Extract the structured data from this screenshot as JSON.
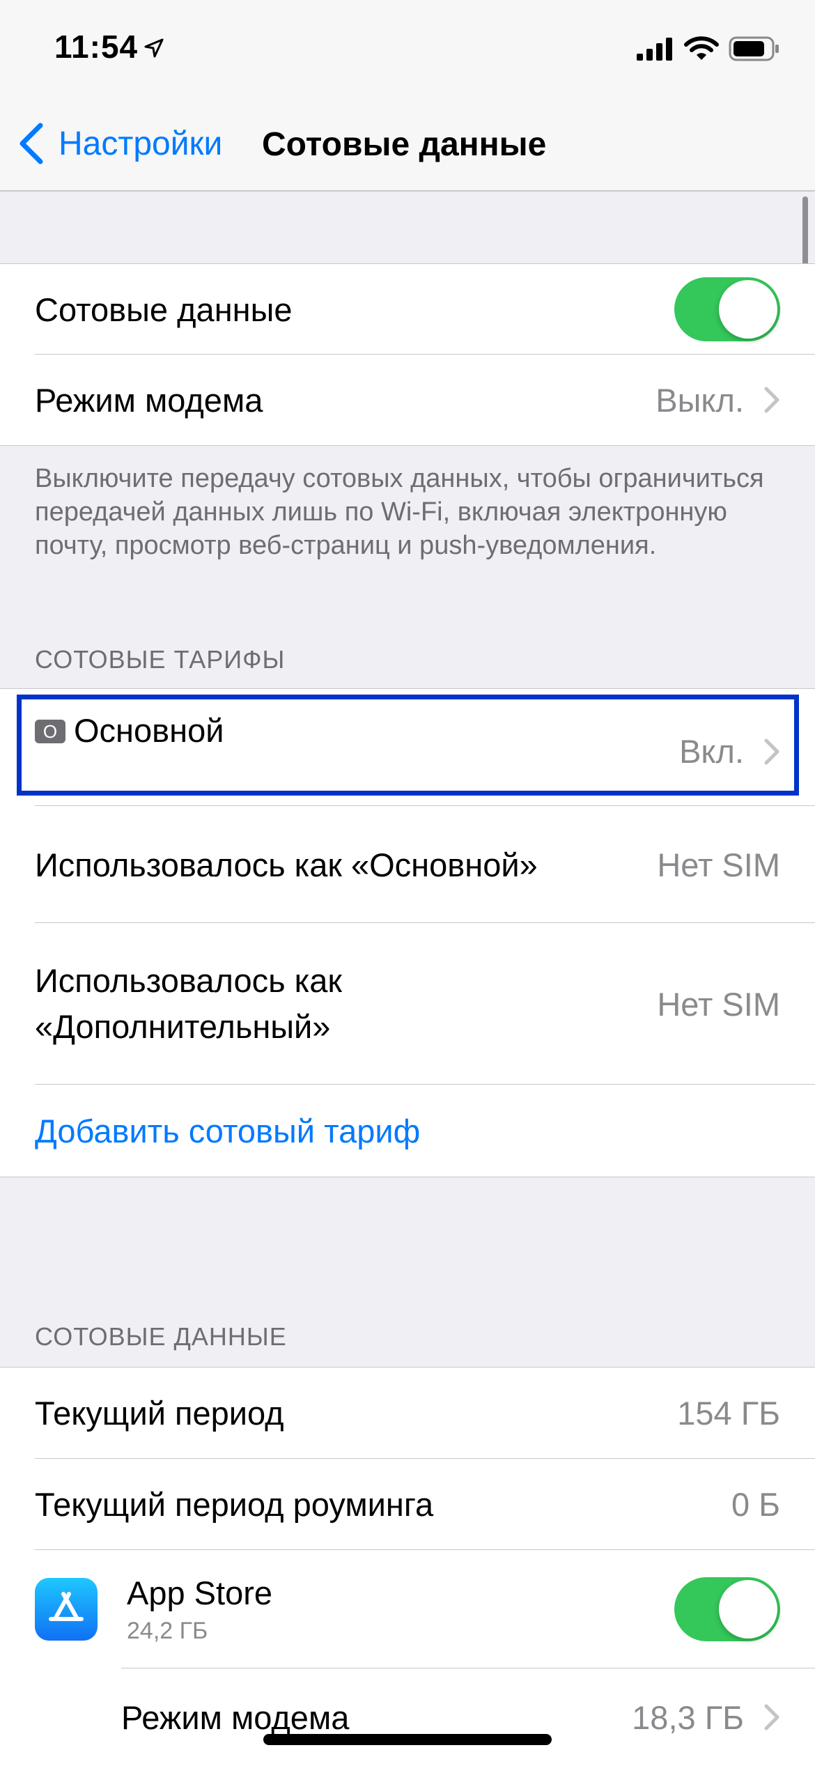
{
  "status_bar": {
    "time": "11:54"
  },
  "nav": {
    "back_label": "Настройки",
    "title": "Сотовые данные"
  },
  "section_main": {
    "cellular_data_label": "Сотовые данные",
    "cellular_data_on": true,
    "hotspot_label": "Режим модема",
    "hotspot_value": "Выкл."
  },
  "footer_note": "Выключите передачу сотовых данных, чтобы ограничиться передачей данных лишь по Wi-Fi, включая электронную почту, просмотр веб-страниц и push-уведомления.",
  "plans": {
    "header": "СОТОВЫЕ ТАРИФЫ",
    "primary_badge": "O",
    "primary_label": "Основной",
    "primary_value": "Вкл.",
    "used_primary_label": "Использовалось как «Основной»",
    "used_primary_value": "Нет SIM",
    "used_secondary_label_line1": "Использовалось как",
    "used_secondary_label_line2": "«Дополнительный»",
    "used_secondary_value": "Нет SIM",
    "add_plan_label": "Добавить сотовый тариф"
  },
  "data_usage": {
    "header": "СОТОВЫЕ ДАННЫЕ",
    "current_period_label": "Текущий период",
    "current_period_value": "154 ГБ",
    "roaming_label": "Текущий период роуминга",
    "roaming_value": "0 Б",
    "app_store_label": "App Store",
    "app_store_usage": "24,2 ГБ",
    "app_store_on": true,
    "hotspot_label": "Режим модема",
    "hotspot_value": "18,3 ГБ"
  },
  "colors": {
    "accent": "#007aff",
    "toggle_on": "#34c759",
    "highlight": "#0033c8"
  }
}
